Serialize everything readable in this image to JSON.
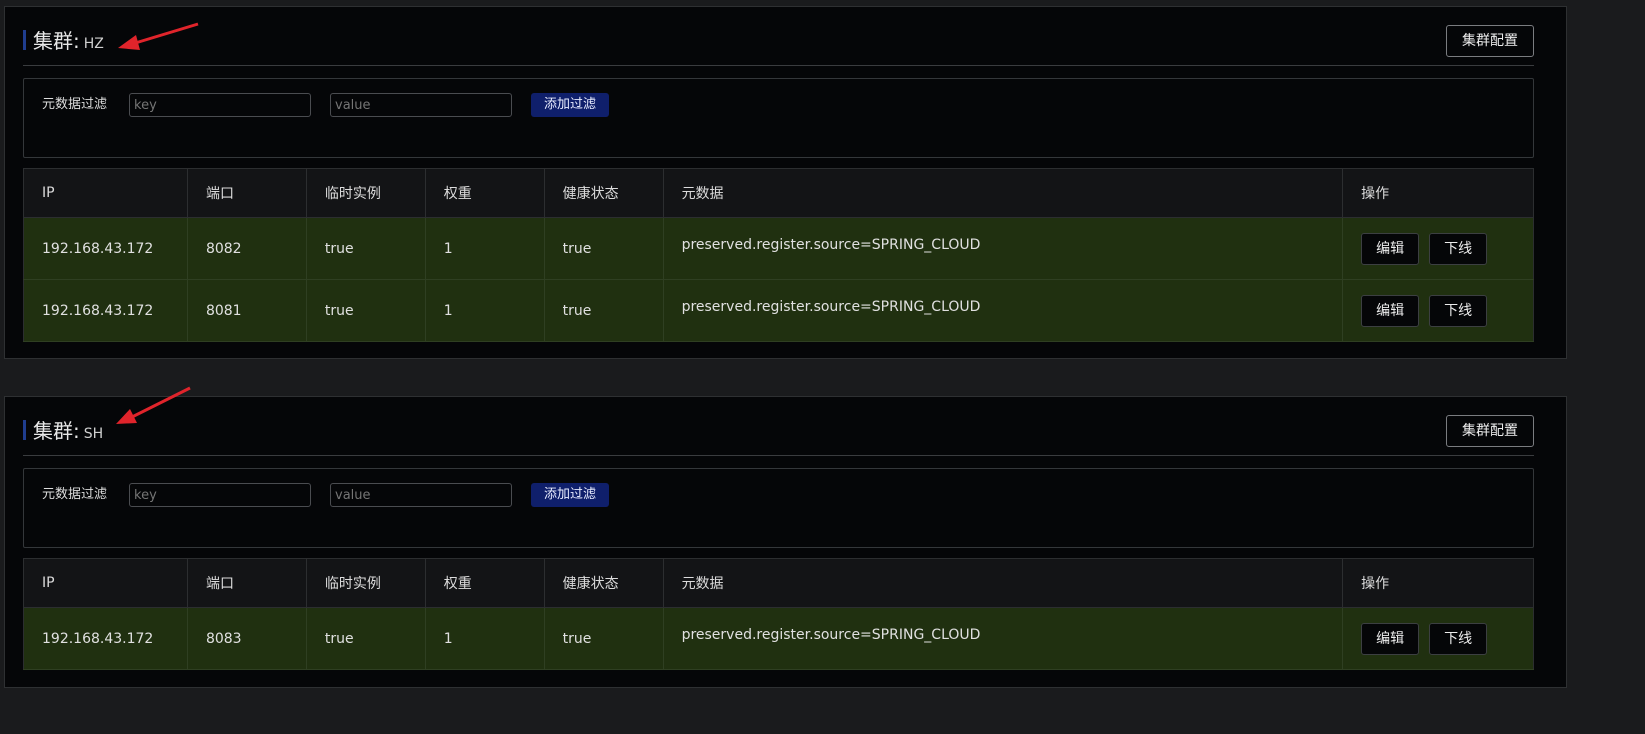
{
  "clusters": [
    {
      "label": "集群:",
      "name": "HZ",
      "config_button": "集群配置",
      "filter": {
        "label": "元数据过滤",
        "key_placeholder": "key",
        "value_placeholder": "value",
        "add_button": "添加过滤"
      },
      "columns": [
        "IP",
        "端口",
        "临时实例",
        "权重",
        "健康状态",
        "元数据",
        "操作"
      ],
      "rows": [
        {
          "ip": "192.168.43.172",
          "port": "8082",
          "ephemeral": "true",
          "weight": "1",
          "healthy": "true",
          "metadata": "preserved.register.source=SPRING_CLOUD",
          "edit": "编辑",
          "offline": "下线"
        },
        {
          "ip": "192.168.43.172",
          "port": "8081",
          "ephemeral": "true",
          "weight": "1",
          "healthy": "true",
          "metadata": "preserved.register.source=SPRING_CLOUD",
          "edit": "编辑",
          "offline": "下线"
        }
      ]
    },
    {
      "label": "集群:",
      "name": "SH",
      "config_button": "集群配置",
      "filter": {
        "label": "元数据过滤",
        "key_placeholder": "key",
        "value_placeholder": "value",
        "add_button": "添加过滤"
      },
      "columns": [
        "IP",
        "端口",
        "临时实例",
        "权重",
        "健康状态",
        "元数据",
        "操作"
      ],
      "rows": [
        {
          "ip": "192.168.43.172",
          "port": "8083",
          "ephemeral": "true",
          "weight": "1",
          "healthy": "true",
          "metadata": "preserved.register.source=SPRING_CLOUD",
          "edit": "编辑",
          "offline": "下线"
        }
      ]
    }
  ],
  "colors": {
    "panel_bg": "#050608",
    "row_bg": "#203010",
    "header_bg": "#131416",
    "accent": "#0f1f6b",
    "annotation_arrow": "#e0242b"
  },
  "icons": [
    "red-arrow-annotation-icon"
  ]
}
